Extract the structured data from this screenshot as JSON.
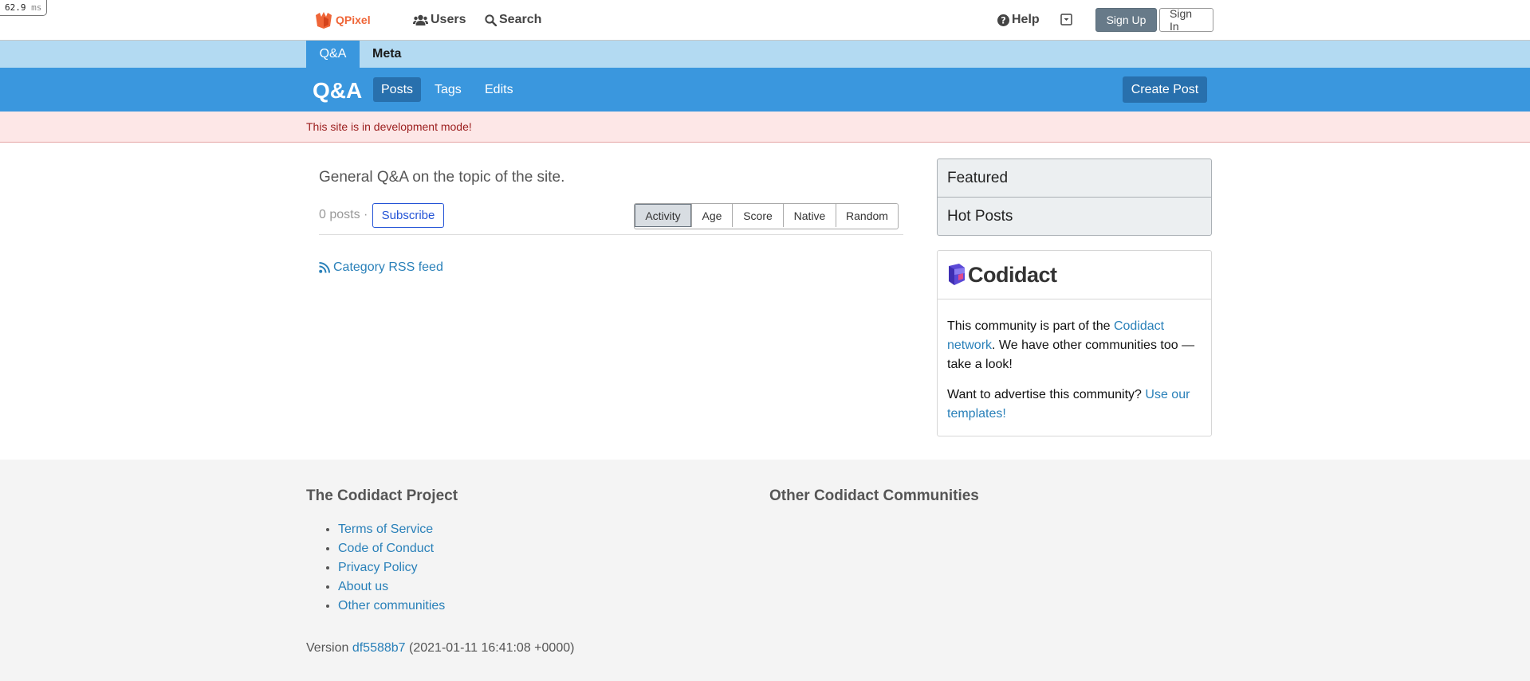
{
  "perf": {
    "value": "62.9",
    "unit": "ms"
  },
  "header": {
    "logo_text": "QPixel",
    "nav": {
      "users": "Users",
      "search": "Search",
      "help": "Help"
    },
    "sign_up": "Sign Up",
    "sign_in": "Sign In"
  },
  "category_tabs": {
    "qa": "Q&A",
    "meta": "Meta"
  },
  "category_header": {
    "title": "Q&A",
    "nav": {
      "posts": "Posts",
      "tags": "Tags",
      "edits": "Edits"
    },
    "create_post": "Create Post"
  },
  "dev_banner": "This site is in development mode!",
  "main": {
    "description": "General Q&A on the topic of the site.",
    "posts_count": "0 posts ·",
    "subscribe": "Subscribe",
    "sort_options": [
      "Activity",
      "Age",
      "Score",
      "Native",
      "Random"
    ],
    "active_sort": "Activity",
    "rss_link": "Category RSS feed"
  },
  "sidebar": {
    "featured": "Featured",
    "hot_posts": "Hot Posts",
    "codidact_logo": "Codidact",
    "community_text_1": "This community is part of the ",
    "community_link": "Codidact network",
    "community_text_2": ". We have other communities too — take a look!",
    "advertise_text": "Want to advertise this community? ",
    "advertise_link": "Use our templates!"
  },
  "footer": {
    "project_heading": "The Codidact Project",
    "other_heading": "Other Codidact Communities",
    "links": [
      "Terms of Service",
      "Code of Conduct",
      "Privacy Policy",
      "About us",
      "Other communities"
    ],
    "version_label": "Version",
    "version_hash": "df5588b7",
    "version_date": "(2021-01-11 16:41:08 +0000)"
  },
  "colors": {
    "brand_orange": "#ef6537",
    "category_blue": "#3a97de",
    "category_tabs_bg": "#b3daf2",
    "active_blue": "#2870ad",
    "dev_banner_bg": "#fde7e7",
    "link": "#2980b9"
  }
}
